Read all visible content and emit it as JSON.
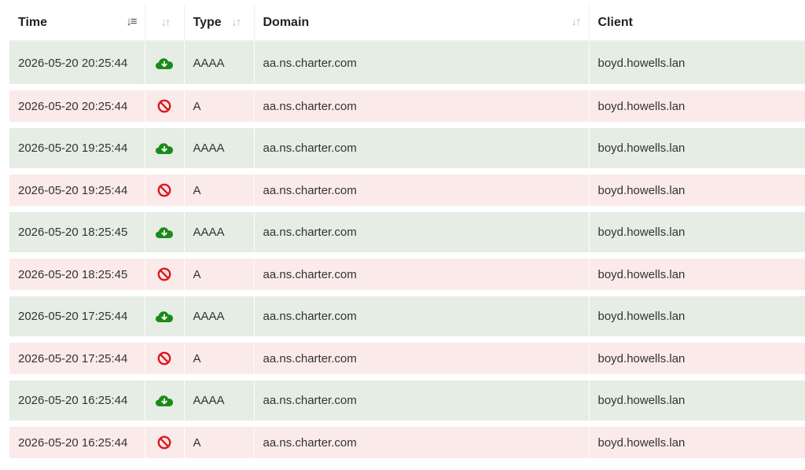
{
  "headers": {
    "time": "Time",
    "status": "",
    "type": "Type",
    "domain": "Domain",
    "client": "Client"
  },
  "colors": {
    "ok_row": "#e5ede5",
    "blocked_row": "#fbeaea",
    "ok_icon": "#1a8a1a",
    "blocked_icon": "#e0161b"
  },
  "rows": [
    {
      "time": "2026-05-20 20:25:44",
      "status": "allowed",
      "status_icon": "cloud-download-icon",
      "type": "AAAA",
      "domain": "aa.ns.charter.com",
      "client": "boyd.howells.lan"
    },
    {
      "time": "2026-05-20 20:25:44",
      "status": "blocked",
      "status_icon": "blocked-icon",
      "type": "A",
      "domain": "aa.ns.charter.com",
      "client": "boyd.howells.lan"
    },
    {
      "time": "2026-05-20 19:25:44",
      "status": "allowed",
      "status_icon": "cloud-download-icon",
      "type": "AAAA",
      "domain": "aa.ns.charter.com",
      "client": "boyd.howells.lan"
    },
    {
      "time": "2026-05-20 19:25:44",
      "status": "blocked",
      "status_icon": "blocked-icon",
      "type": "A",
      "domain": "aa.ns.charter.com",
      "client": "boyd.howells.lan"
    },
    {
      "time": "2026-05-20 18:25:45",
      "status": "allowed",
      "status_icon": "cloud-download-icon",
      "type": "AAAA",
      "domain": "aa.ns.charter.com",
      "client": "boyd.howells.lan"
    },
    {
      "time": "2026-05-20 18:25:45",
      "status": "blocked",
      "status_icon": "blocked-icon",
      "type": "A",
      "domain": "aa.ns.charter.com",
      "client": "boyd.howells.lan"
    },
    {
      "time": "2026-05-20 17:25:44",
      "status": "allowed",
      "status_icon": "cloud-download-icon",
      "type": "AAAA",
      "domain": "aa.ns.charter.com",
      "client": "boyd.howells.lan"
    },
    {
      "time": "2026-05-20 17:25:44",
      "status": "blocked",
      "status_icon": "blocked-icon",
      "type": "A",
      "domain": "aa.ns.charter.com",
      "client": "boyd.howells.lan"
    },
    {
      "time": "2026-05-20 16:25:44",
      "status": "allowed",
      "status_icon": "cloud-download-icon",
      "type": "AAAA",
      "domain": "aa.ns.charter.com",
      "client": "boyd.howells.lan"
    },
    {
      "time": "2026-05-20 16:25:44",
      "status": "blocked",
      "status_icon": "blocked-icon",
      "type": "A",
      "domain": "aa.ns.charter.com",
      "client": "boyd.howells.lan"
    }
  ]
}
